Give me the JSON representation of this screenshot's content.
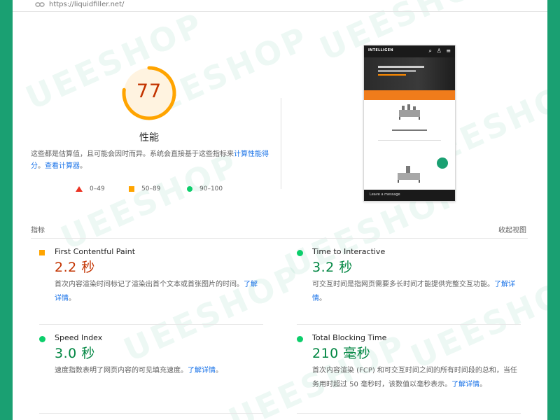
{
  "url": "https://liquidfiller.net/",
  "category": {
    "score": "77",
    "title": "性能",
    "description_prefix": "这些都是估算值，且可能会因时而异。系统会直接基于这些指标来",
    "link_calc": "计算性能得分",
    "separator": "。",
    "link_view": "查看计算器",
    "description_suffix": "。",
    "score_fraction": 0.77,
    "color": "#ffa400"
  },
  "legend": [
    {
      "shape": "triangle",
      "range": "0–49",
      "color": "#eb3323"
    },
    {
      "shape": "square",
      "range": "50–89",
      "color": "#ffa400"
    },
    {
      "shape": "circle",
      "range": "90–100",
      "color": "#0cce6b"
    }
  ],
  "screenshot": {
    "logo": "INTELLIGEN",
    "footer": "Leave a message"
  },
  "metrics_section": {
    "title": "指标",
    "collapse_label": "收起视图"
  },
  "metrics": [
    {
      "name": "First Contentful Paint",
      "value": "2.2 秒",
      "status": "average",
      "description": "首次内容渲染时间标记了渲染出首个文本或首张图片的时间。",
      "link": "了解详情",
      "end": "。"
    },
    {
      "name": "Time to Interactive",
      "value": "3.2 秒",
      "status": "pass",
      "description": "可交互时间是指网页需要多长时间才能提供完整交互功能。",
      "link": "了解详情",
      "end": "。"
    },
    {
      "name": "Speed Index",
      "value": "3.0 秒",
      "status": "pass",
      "description": "速度指数表明了网页内容的可见填充速度。",
      "link": "了解详情",
      "end": "。"
    },
    {
      "name": "Total Blocking Time",
      "value": "210 毫秒",
      "status": "pass",
      "description": "首次内容渲染 (FCP) 和可交互时间之间的所有时间段的总和，当任务用时超过 50 毫秒时，该数值以毫秒表示。",
      "link": "了解详情",
      "end": "。"
    }
  ],
  "watermark": "UEESHOP"
}
